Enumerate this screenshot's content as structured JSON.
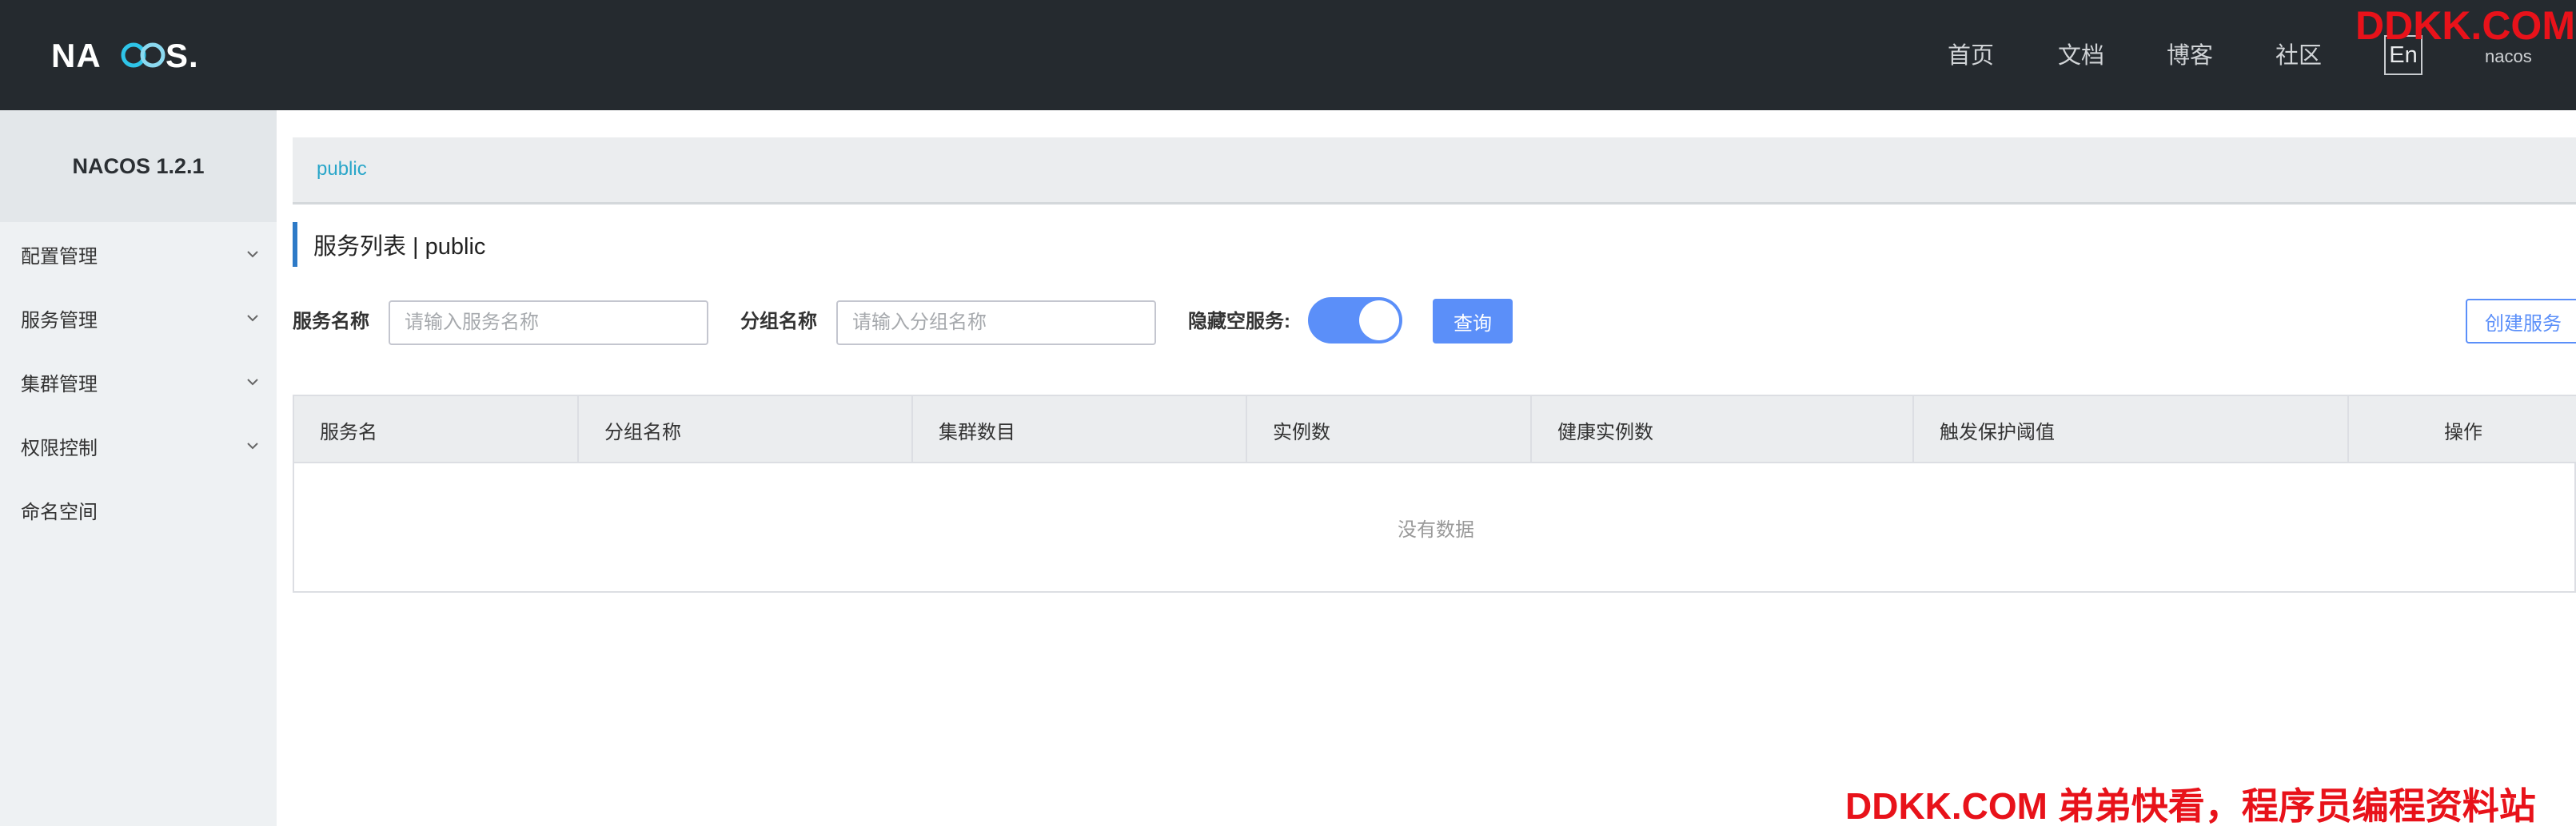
{
  "header": {
    "logo_text": "NACOS.",
    "nav": [
      "首页",
      "文档",
      "博客",
      "社区"
    ],
    "lang_toggle": "En",
    "user": "nacos"
  },
  "sidebar": {
    "version": "NACOS 1.2.1",
    "items": [
      {
        "label": "配置管理",
        "expandable": true,
        "icon": "chevron-down-icon"
      },
      {
        "label": "服务管理",
        "expandable": true,
        "icon": "chevron-down-icon"
      },
      {
        "label": "集群管理",
        "expandable": true,
        "icon": "chevron-down-icon"
      },
      {
        "label": "权限控制",
        "expandable": true,
        "icon": "chevron-down-icon"
      },
      {
        "label": "命名空间",
        "expandable": false
      }
    ]
  },
  "namespace": {
    "tabs": [
      "public"
    ]
  },
  "page": {
    "title": "服务列表 | public"
  },
  "filters": {
    "service_name_label": "服务名称",
    "service_name_value": "",
    "service_name_placeholder": "请输入服务名称",
    "group_name_label": "分组名称",
    "group_name_value": "",
    "group_name_placeholder": "请输入分组名称",
    "hide_empty_label": "隐藏空服务:",
    "hide_empty_on": true,
    "query_button": "查询",
    "create_button": "创建服务"
  },
  "table": {
    "columns": [
      "服务名",
      "分组名称",
      "集群数目",
      "实例数",
      "健康实例数",
      "触发保护阈值",
      "操作"
    ],
    "rows": [],
    "empty_text": "没有数据"
  },
  "watermark": {
    "top": "DDKK.COM",
    "bottom": "DDKK.COM 弟弟快看，程序员编程资料站"
  },
  "colors": {
    "topbar": "#252a2f",
    "sidebar": "#eef1f3",
    "primary": "#5b8ff9",
    "link": "#29a6c9",
    "watermark": "#e8121a"
  }
}
